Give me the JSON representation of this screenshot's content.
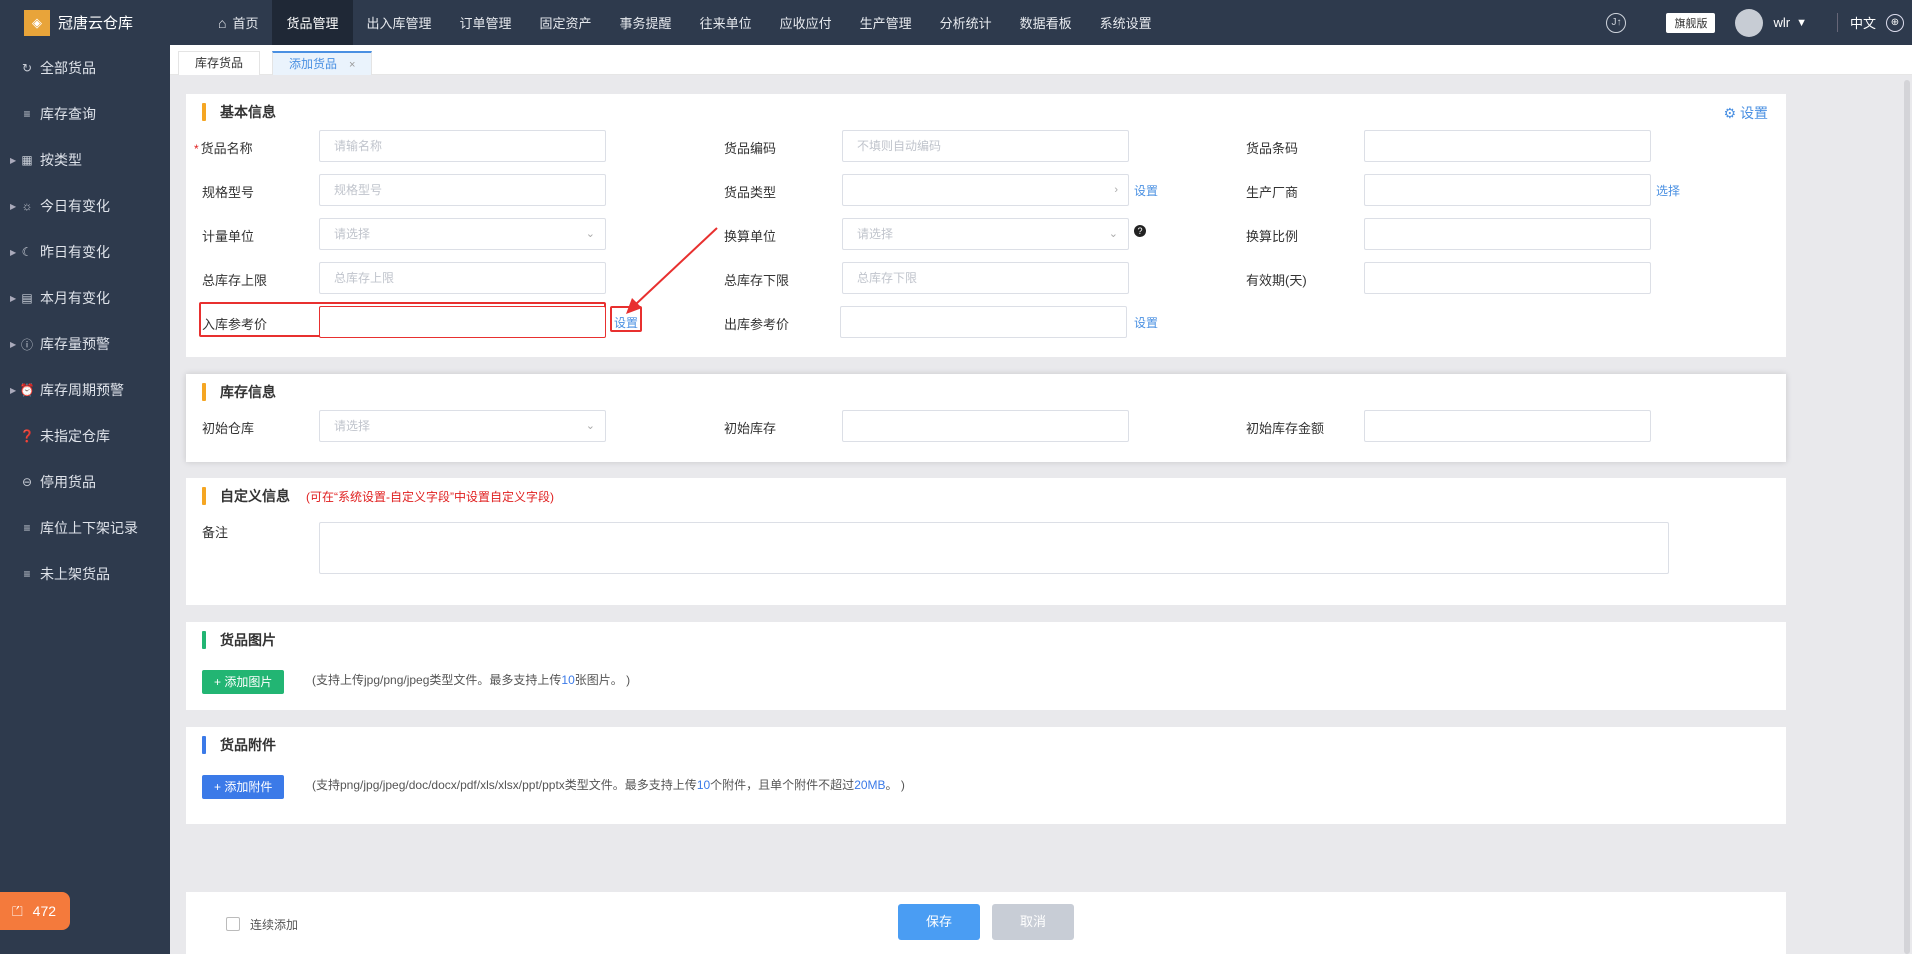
{
  "app": {
    "name": "冠唐云仓库"
  },
  "nav": {
    "home": "首页",
    "items": [
      "货品管理",
      "出入库管理",
      "订单管理",
      "固定资产",
      "事务提醒",
      "往来单位",
      "应收应付",
      "生产管理",
      "分析统计",
      "数据看板",
      "系统设置"
    ],
    "edition": "旗舰版",
    "user": "wlr",
    "lang": "中文"
  },
  "sidebar": {
    "items": [
      "全部货品",
      "库存查询",
      "按类型",
      "今日有变化",
      "昨日有变化",
      "本月有变化",
      "库存量预警",
      "库存周期预警",
      "未指定仓库",
      "停用货品",
      "库位上下架记录",
      "未上架货品"
    ],
    "badge": "472"
  },
  "tabs": [
    "库存货品",
    "添加货品"
  ],
  "basic": {
    "title": "基本信息",
    "settings": "设置",
    "fields": {
      "name_label": "货品名称",
      "name_ph": "请输名称",
      "code_label": "货品编码",
      "code_ph": "不填则自动编码",
      "barcode_label": "货品条码",
      "spec_label": "规格型号",
      "spec_ph": "规格型号",
      "type_label": "货品类型",
      "type_link": "设置",
      "maker_label": "生产厂商",
      "maker_link": "选择",
      "unit_label": "计量单位",
      "unit_ph": "请选择",
      "conv_unit_label": "换算单位",
      "conv_unit_ph": "请选择",
      "conv_ratio_label": "换算比例",
      "max_label": "总库存上限",
      "max_ph": "总库存上限",
      "min_label": "总库存下限",
      "min_ph": "总库存下限",
      "expiry_label": "有效期(天)",
      "in_price_label": "入库参考价",
      "in_price_link": "设置",
      "out_price_label": "出库参考价",
      "out_price_link": "设置"
    }
  },
  "stock": {
    "title": "库存信息",
    "wh_label": "初始仓库",
    "wh_ph": "请选择",
    "qty_label": "初始库存",
    "amt_label": "初始库存金额"
  },
  "custom": {
    "title": "自定义信息",
    "note": "(可在“系统设置-自定义字段”中设置自定义字段)",
    "remark_label": "备注"
  },
  "images": {
    "title": "货品图片",
    "btn": "添加图片",
    "hint_a": "(支持上传jpg/png/jpeg类型文件。最多支持上传",
    "hint_num": "10",
    "hint_b": "张图片。 )"
  },
  "attach": {
    "title": "货品附件",
    "btn": "添加附件",
    "hint_a": "(支持png/jpg/jpeg/doc/docx/pdf/xls/xlsx/ppt/pptx类型文件。最多支持上传",
    "hint_num": "10",
    "hint_b": "个附件，且单个附件不超过",
    "hint_size": "20MB",
    "hint_c": "。 )"
  },
  "footer": {
    "continuous": "连续添加",
    "save": "保存",
    "cancel": "取消"
  },
  "colors": {
    "accent": "#4a90e2",
    "orange_bar": "#f5a623",
    "green": "#22b573",
    "blue": "#3b7ae8",
    "highlight": "#e8302f"
  }
}
